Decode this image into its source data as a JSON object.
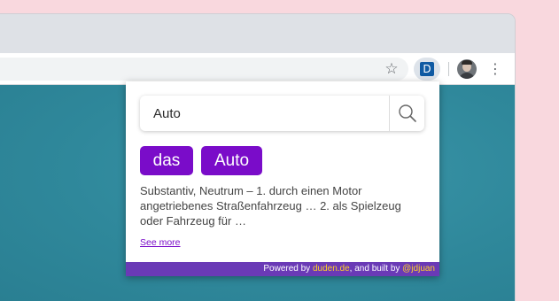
{
  "toolbar": {
    "star_icon": "star-outline-icon",
    "extension_label": "D",
    "extension_color": "#0f5aa3",
    "menu_icon": "three-dot-vertical-icon"
  },
  "popup": {
    "search": {
      "value": "Auto"
    },
    "chips": [
      "das",
      "Auto"
    ],
    "definition": "Substantiv, Neutrum – 1. durch einen Motor angetriebenes Straßenfahrzeug … 2. als Spielzeug oder Fahrzeug für …",
    "see_more": "See more",
    "footer": {
      "prefix": "Powered by ",
      "source": "duden.de",
      "middle": ", and built by ",
      "author": "@jdjuan"
    },
    "accent_color": "#7a0cc9",
    "footer_color": "#6a3ab6",
    "highlight_color": "#ffcf2a"
  }
}
